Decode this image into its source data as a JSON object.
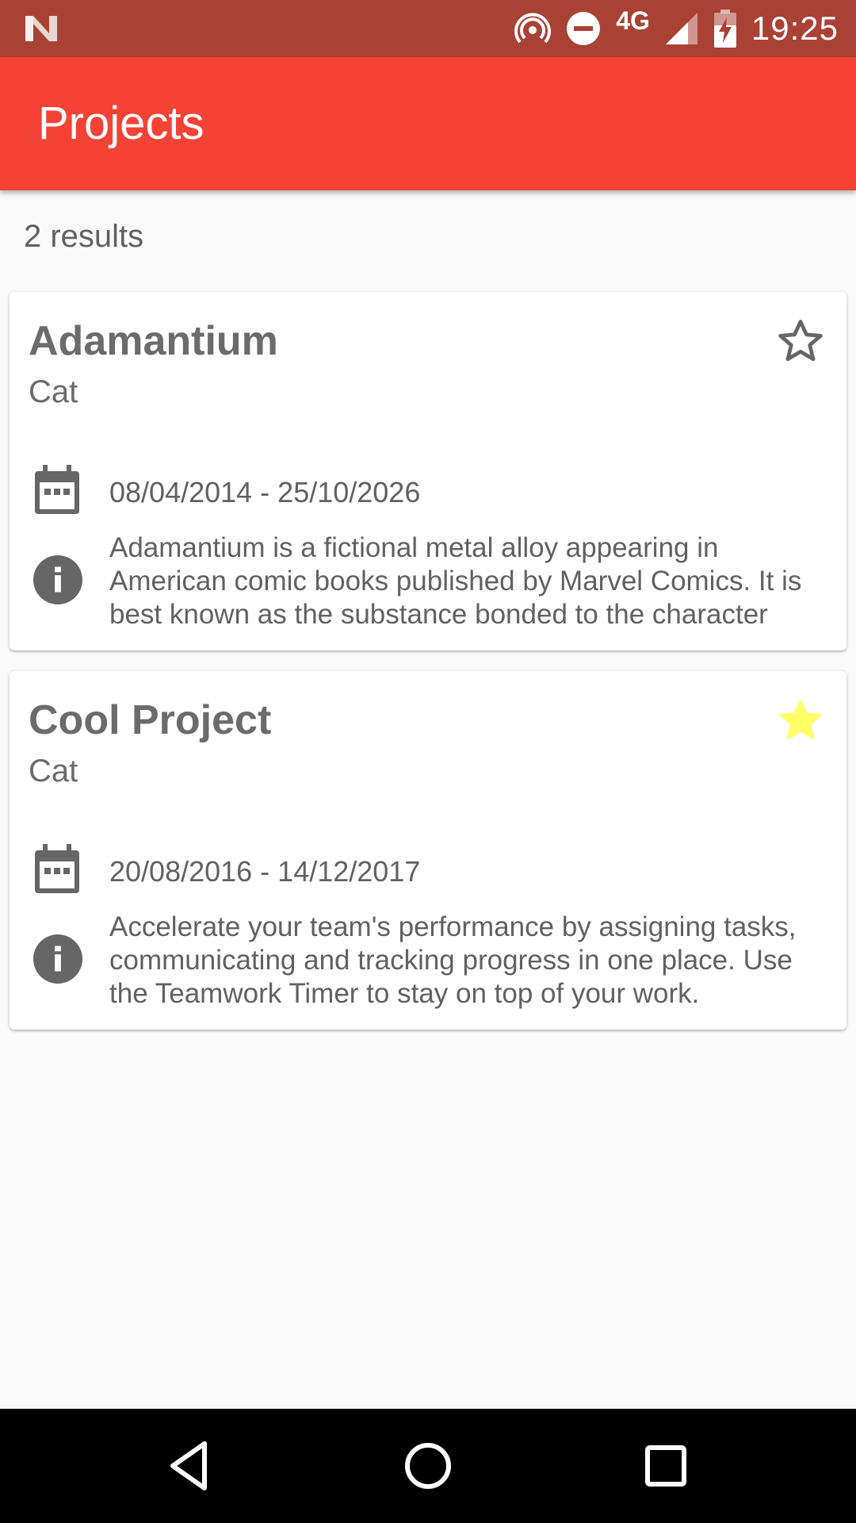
{
  "status_bar": {
    "network": "4G",
    "time": "19:25",
    "icons": [
      "android-n-logo-icon",
      "hotspot-icon",
      "do-not-disturb-icon",
      "signal-icon",
      "battery-charging-icon"
    ]
  },
  "app_bar": {
    "title": "Projects"
  },
  "results_label": "2 results",
  "projects": [
    {
      "name": "Adamantium",
      "category": "Cat",
      "dates": "08/04/2014 - 25/10/2026",
      "description": "Adamantium is a fictional metal alloy appearing in American comic books published by Marvel Comics. It is best known as the substance bonded to the character",
      "starred": false
    },
    {
      "name": "Cool Project",
      "category": "Cat",
      "dates": "20/08/2016 - 14/12/2017",
      "description": "Accelerate your team's performance by assigning tasks, communicating and tracking progress in one place. Use the Teamwork Timer to stay on top of your work.",
      "starred": true
    }
  ],
  "nav_bar": {
    "buttons": [
      "back-icon",
      "home-icon",
      "recents-icon"
    ]
  },
  "colors": {
    "status_bar": "#a94234",
    "app_bar": "#f44336",
    "star_active": "#ffff66",
    "icon_gray": "#666666"
  }
}
